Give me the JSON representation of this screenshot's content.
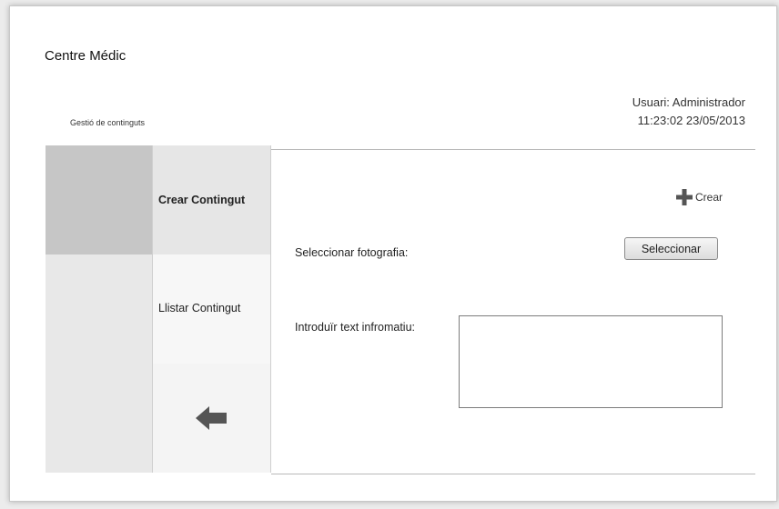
{
  "app": {
    "title": "Centre Médic",
    "section": "Gestió de continguts"
  },
  "user": {
    "label": "Usuari: Administrador",
    "datetime": "11:23:02 23/05/2013"
  },
  "nav": {
    "items": [
      {
        "label": "Crear Contingut",
        "selected": true
      },
      {
        "label": "Llistar Contingut",
        "selected": false
      }
    ],
    "back_icon": "arrow-left-icon"
  },
  "form": {
    "create_label": "Crear",
    "create_icon": "plus-icon",
    "photo_label": "Seleccionar fotografia:",
    "select_button": "Seleccionar",
    "text_label": "Introduïr text infromatiu:",
    "text_value": ""
  },
  "colors": {
    "selected_bg": "#c6c6c6",
    "nav_selected_bg": "#e6e6e6",
    "icon": "#555555"
  }
}
